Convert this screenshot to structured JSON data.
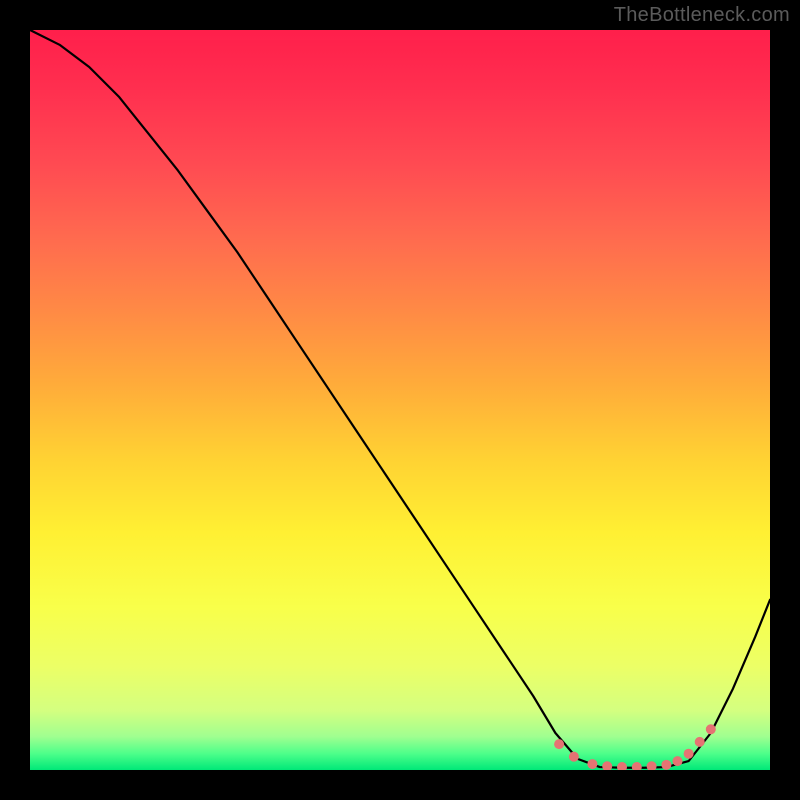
{
  "watermark": "TheBottleneck.com",
  "chart_data": {
    "type": "line",
    "title": "",
    "xlabel": "",
    "ylabel": "",
    "xlim": [
      0,
      100
    ],
    "ylim": [
      0,
      100
    ],
    "series": [
      {
        "name": "curve",
        "x": [
          0,
          4,
          8,
          12,
          16,
          20,
          24,
          28,
          32,
          36,
          40,
          44,
          48,
          52,
          56,
          60,
          64,
          68,
          71,
          74,
          77,
          80,
          83,
          86,
          89,
          92,
          95,
          98,
          100
        ],
        "y": [
          100,
          98,
          95,
          91,
          86,
          81,
          75.5,
          70,
          64,
          58,
          52,
          46,
          40,
          34,
          28,
          22,
          16,
          10,
          5,
          1.5,
          0.4,
          0.3,
          0.3,
          0.4,
          1.2,
          5,
          11,
          18,
          23
        ],
        "color": "#000000"
      }
    ],
    "markers": {
      "name": "bottom-dots",
      "x": [
        71.5,
        73.5,
        76,
        78,
        80,
        82,
        84,
        86,
        87.5,
        89,
        90.5,
        92
      ],
      "y": [
        3.5,
        1.8,
        0.8,
        0.5,
        0.4,
        0.4,
        0.5,
        0.7,
        1.2,
        2.2,
        3.8,
        5.5
      ],
      "color": "#e57373",
      "size": 5
    },
    "gradient_stops": [
      {
        "offset": 0.0,
        "color": "#ff1f4b"
      },
      {
        "offset": 0.08,
        "color": "#ff2f4f"
      },
      {
        "offset": 0.18,
        "color": "#ff4a52"
      },
      {
        "offset": 0.28,
        "color": "#ff6a4f"
      },
      {
        "offset": 0.38,
        "color": "#ff8a45"
      },
      {
        "offset": 0.48,
        "color": "#ffac3a"
      },
      {
        "offset": 0.58,
        "color": "#ffd233"
      },
      {
        "offset": 0.68,
        "color": "#fff033"
      },
      {
        "offset": 0.78,
        "color": "#f8ff4a"
      },
      {
        "offset": 0.86,
        "color": "#ecff66"
      },
      {
        "offset": 0.92,
        "color": "#d4ff80"
      },
      {
        "offset": 0.955,
        "color": "#9fff90"
      },
      {
        "offset": 0.978,
        "color": "#4dff8a"
      },
      {
        "offset": 1.0,
        "color": "#00e878"
      }
    ]
  }
}
